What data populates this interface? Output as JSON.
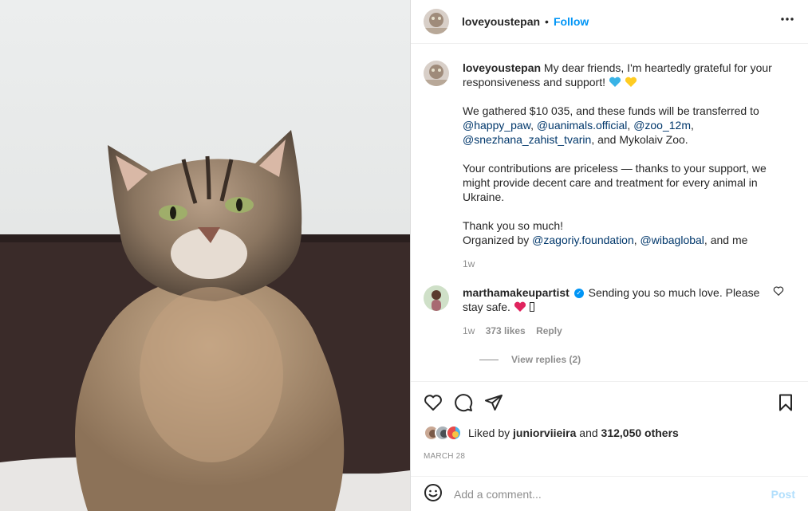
{
  "post": {
    "username": "loveyoustepan",
    "follow_label": "Follow",
    "more_label": "•••"
  },
  "caption": {
    "username": "loveyoustepan",
    "line1": "My dear friends, I'm heartedly grateful for your responsiveness and support!",
    "p2_start": "We gathered $10 035, and these funds will be transferred to",
    "mentions_p2": [
      "@happy_paw",
      "@uanimals.official",
      "@zoo_12m",
      "@snezhana_zahist_tvarin"
    ],
    "p2_end": ", and Mykolaiv Zoo.",
    "p3": "Your contributions are priceless — thanks to your support, we might provide decent care and treatment for every animal in Ukraine.",
    "p4_line1": "Thank you so much!",
    "p4_organized": "Organized by",
    "mentions_p4": [
      "@zagoriy.foundation",
      "@wibaglobal"
    ],
    "p4_end": ", and me",
    "time": "1w"
  },
  "comment": {
    "username": "marthamakeupartist",
    "text": "Sending you so much love. Please stay safe.",
    "time": "1w",
    "likes": "373 likes",
    "reply_label": "Reply",
    "view_replies": "View replies (2)"
  },
  "likes": {
    "liked_by": "Liked by",
    "user": "juniorviieira",
    "and": "and",
    "others": "312,050 others"
  },
  "date": "MARCH 28",
  "add_comment": {
    "placeholder": "Add a comment...",
    "post_label": "Post"
  },
  "colors": {
    "link": "#0095f6",
    "mention": "#00376b",
    "post_disabled": "#b2dffc",
    "muted": "#8e8e8e",
    "heart_blue": "#39b3e6",
    "heart_yellow": "#ffcc22",
    "heart_red": "#e0245e"
  }
}
